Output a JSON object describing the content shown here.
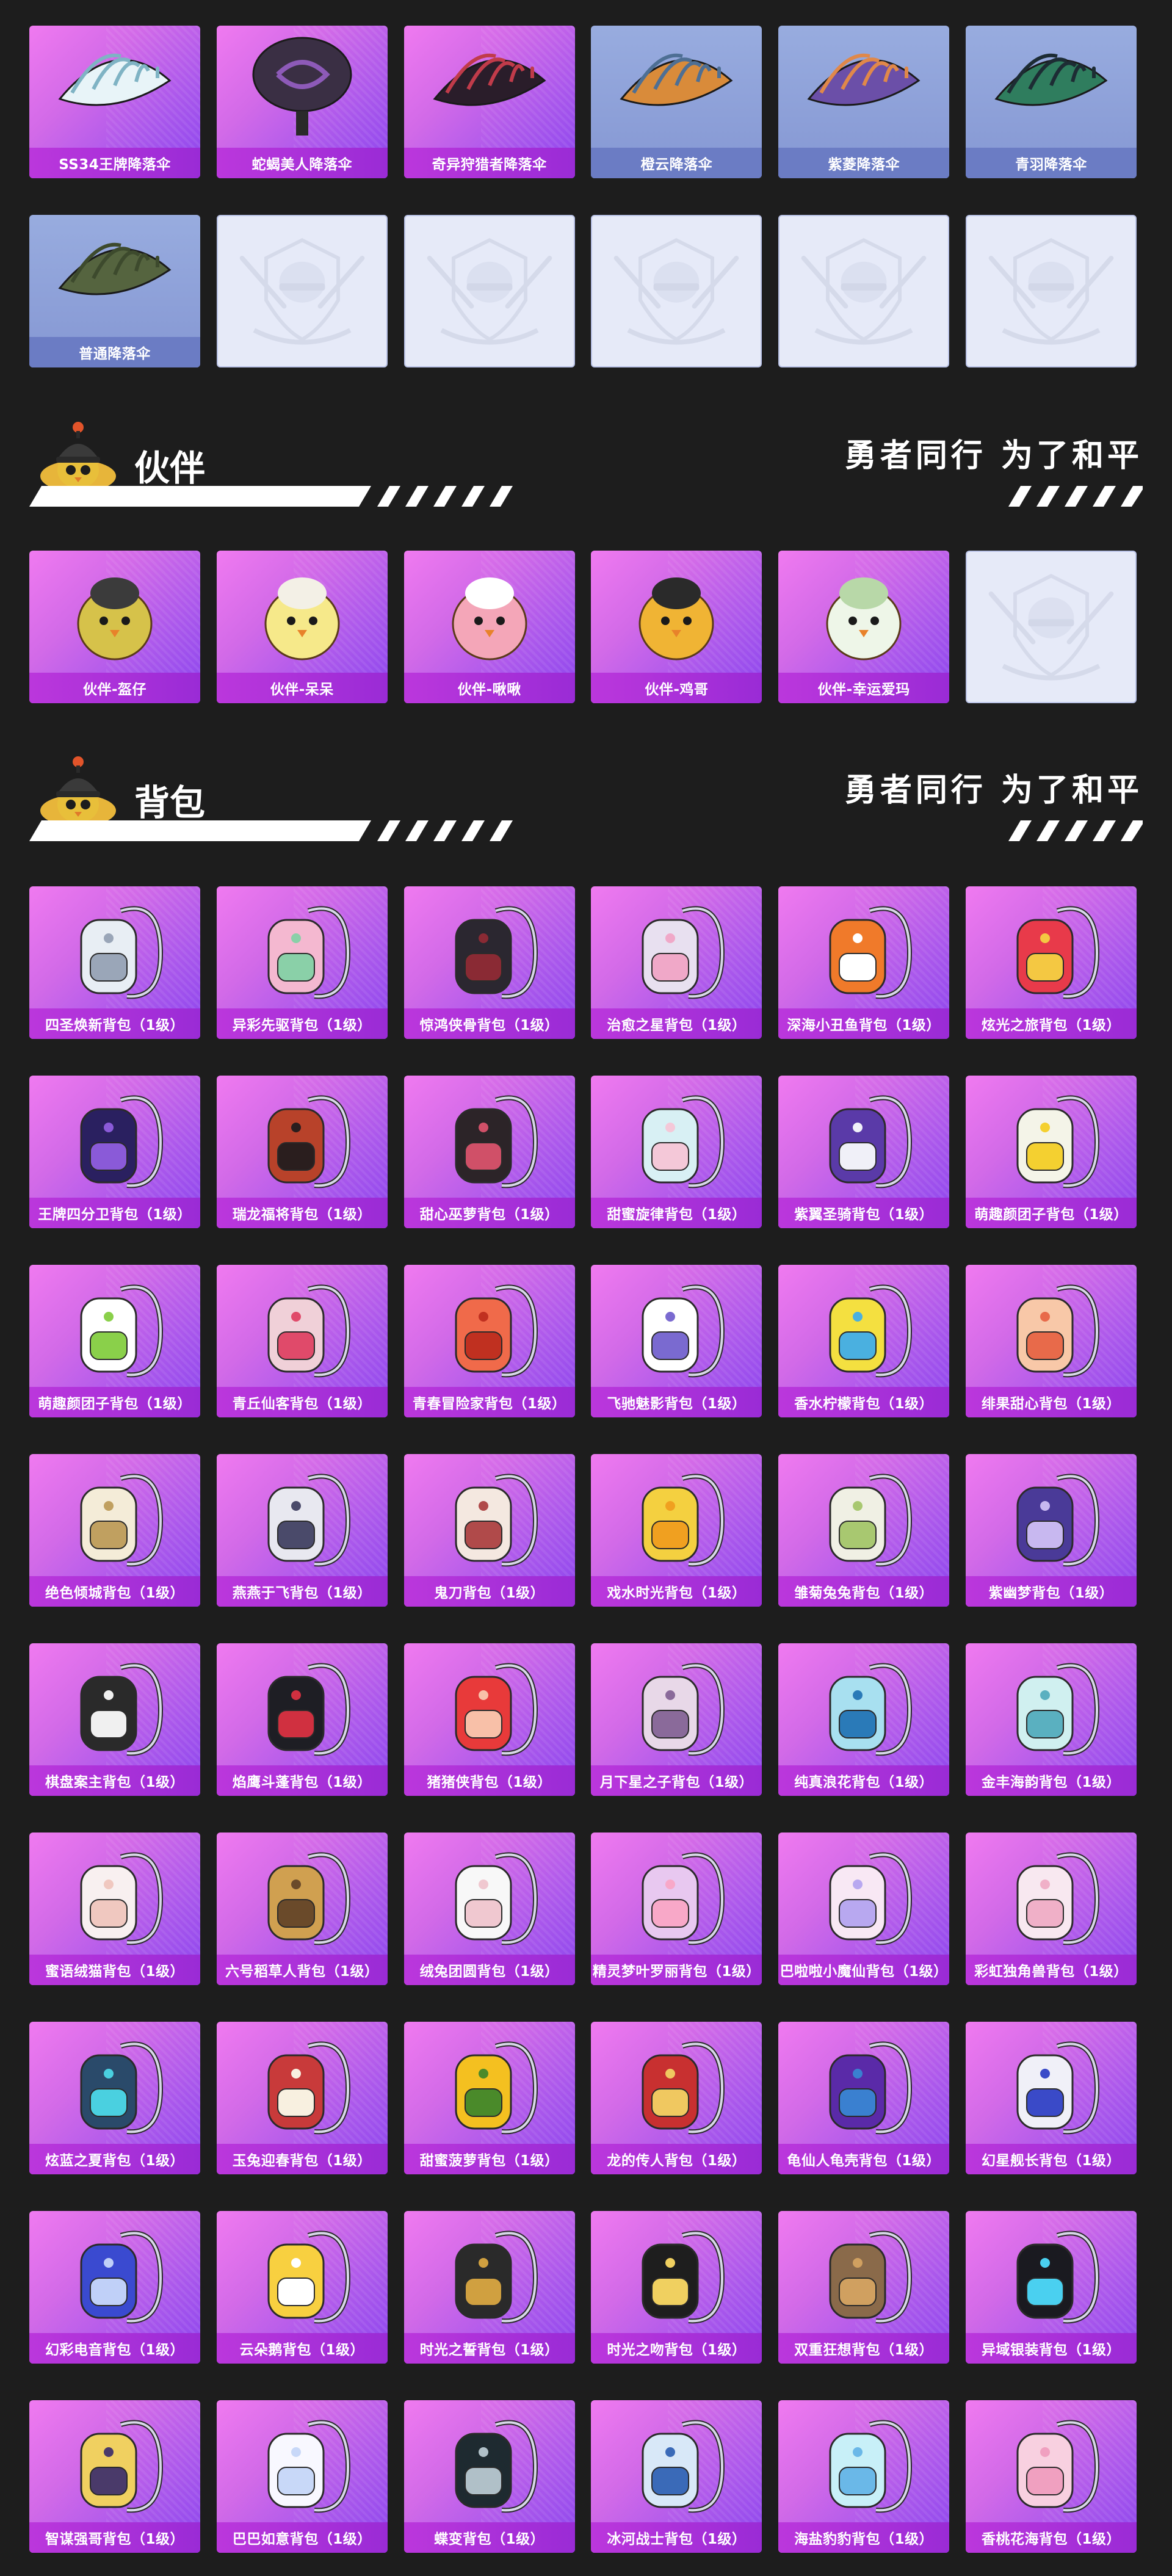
{
  "parachutes": [
    {
      "label": "SS34王牌降落伞",
      "style": "purple",
      "art": "canopy",
      "c1": "#e8f4f8",
      "c2": "#7fb3c4"
    },
    {
      "label": "蛇蝎美人降落伞",
      "style": "purple",
      "art": "round",
      "c1": "#3a2f44",
      "c2": "#8d5ab8"
    },
    {
      "label": "奇异狩猎者降落伞",
      "style": "purple",
      "art": "canopy",
      "c1": "#2a1d2a",
      "c2": "#c03b4a"
    },
    {
      "label": "橙云降落伞",
      "style": "blue",
      "art": "canopy",
      "c1": "#d98b3a",
      "c2": "#4e6f94"
    },
    {
      "label": "紫菱降落伞",
      "style": "blue",
      "art": "canopy",
      "c1": "#6b4fa8",
      "c2": "#e0884a"
    },
    {
      "label": "青羽降落伞",
      "style": "blue",
      "art": "canopy",
      "c1": "#2f7d5e",
      "c2": "#1d2c34"
    },
    {
      "label": "普通降落伞",
      "style": "blue",
      "art": "canopy",
      "c1": "#55643f",
      "c2": "#3d4a2d"
    },
    {
      "label": "",
      "style": "empty",
      "art": "emblem"
    },
    {
      "label": "",
      "style": "empty",
      "art": "emblem"
    },
    {
      "label": "",
      "style": "empty",
      "art": "emblem"
    },
    {
      "label": "",
      "style": "empty",
      "art": "emblem"
    },
    {
      "label": "",
      "style": "empty",
      "art": "emblem"
    }
  ],
  "companion_section": {
    "title": "伙伴",
    "slogan": "勇者同行 为了和平"
  },
  "companions": [
    {
      "label": "伙伴-盔仔",
      "style": "purple",
      "art": "chick",
      "c1": "#d6c24a",
      "c2": "#3b3b3b"
    },
    {
      "label": "伙伴-呆呆",
      "style": "purple",
      "art": "chick",
      "c1": "#f6e98a",
      "c2": "#f3f0e6"
    },
    {
      "label": "伙伴-啾啾",
      "style": "purple",
      "art": "chick",
      "c1": "#f4a6b8",
      "c2": "#ffffff"
    },
    {
      "label": "伙伴-鸡哥",
      "style": "purple",
      "art": "chick",
      "c1": "#f0b434",
      "c2": "#2a2a2a"
    },
    {
      "label": "伙伴-幸运爱玛",
      "style": "purple",
      "art": "chick",
      "c1": "#eef6e8",
      "c2": "#b8d8a8"
    },
    {
      "label": "",
      "style": "empty",
      "art": "emblem"
    }
  ],
  "backpack_section": {
    "title": "背包",
    "slogan": "勇者同行 为了和平"
  },
  "backpacks": [
    {
      "label": "四圣焕新背包（1级）",
      "c1": "#e8eef4",
      "c2": "#9aa6b8"
    },
    {
      "label": "异彩先驱背包（1级）",
      "c1": "#f4b8d0",
      "c2": "#8ad0a8"
    },
    {
      "label": "惊鸿侠骨背包（1级）",
      "c1": "#2b2730",
      "c2": "#8a2a34"
    },
    {
      "label": "治愈之星背包（1级）",
      "c1": "#e8e0f0",
      "c2": "#f0a8c8"
    },
    {
      "label": "深海小丑鱼背包（1级）",
      "c1": "#f07a2a",
      "c2": "#ffffff"
    },
    {
      "label": "炫光之旅背包（1级）",
      "c1": "#e83a4a",
      "c2": "#f4c842"
    },
    {
      "label": "王牌四分卫背包（1级）",
      "c1": "#2a2060",
      "c2": "#8a5ad8"
    },
    {
      "label": "瑞龙福将背包（1级）",
      "c1": "#b8422a",
      "c2": "#2a1e1e"
    },
    {
      "label": "甜心巫萝背包（1级）",
      "c1": "#2c2428",
      "c2": "#d05068"
    },
    {
      "label": "甜蜜旋律背包（1级）",
      "c1": "#d8f0f4",
      "c2": "#f4c8d8"
    },
    {
      "label": "紫翼圣骑背包（1级）",
      "c1": "#5a3aa8",
      "c2": "#f0f0f8"
    },
    {
      "label": "萌趣颜团子背包（1级）",
      "c1": "#f4f4e8",
      "c2": "#f4d030"
    },
    {
      "label": "萌趣颜团子背包（1级）",
      "c1": "#ffffff",
      "c2": "#8ad04a"
    },
    {
      "label": "青丘仙客背包（1级）",
      "c1": "#f0d0d8",
      "c2": "#e04a6a"
    },
    {
      "label": "青春冒险家背包（1级）",
      "c1": "#f06a4a",
      "c2": "#c03020"
    },
    {
      "label": "飞驰魅影背包（1级）",
      "c1": "#ffffff",
      "c2": "#7a6ad0"
    },
    {
      "label": "香水柠檬背包（1级）",
      "c1": "#f4e040",
      "c2": "#4ab0e0"
    },
    {
      "label": "绯果甜心背包（1级）",
      "c1": "#f8c8a8",
      "c2": "#e86a4a"
    },
    {
      "label": "绝色倾城背包（1级）",
      "c1": "#f4ecd8",
      "c2": "#c0a060"
    },
    {
      "label": "燕燕于飞背包（1级）",
      "c1": "#e8e8f0",
      "c2": "#4a4a6a"
    },
    {
      "label": "鬼刀背包（1级）",
      "c1": "#f4e8e0",
      "c2": "#b04a4a"
    },
    {
      "label": "戏水时光背包（1级）",
      "c1": "#f4d040",
      "c2": "#f0a020"
    },
    {
      "label": "雏菊兔兔背包（1级）",
      "c1": "#f0f0e4",
      "c2": "#a8c870"
    },
    {
      "label": "紫幽梦背包（1级）",
      "c1": "#4a3a98",
      "c2": "#c8b8f0"
    },
    {
      "label": "棋盘案主背包（1级）",
      "c1": "#2a2a2a",
      "c2": "#f0f0f0"
    },
    {
      "label": "焰鹰斗蓬背包（1级）",
      "c1": "#1e1e24",
      "c2": "#d03040"
    },
    {
      "label": "猪猪侠背包（1级）",
      "c1": "#e83a3a",
      "c2": "#f8c0a8"
    },
    {
      "label": "月下星之子背包（1级）",
      "c1": "#e8d8e8",
      "c2": "#8a6a9a"
    },
    {
      "label": "纯真浪花背包（1级）",
      "c1": "#a8e0f0",
      "c2": "#2a7ab8"
    },
    {
      "label": "金丰海韵背包（1级）",
      "c1": "#d0f0f0",
      "c2": "#5ab0c0"
    },
    {
      "label": "蜜语绒猫背包（1级）",
      "c1": "#f8f0f0",
      "c2": "#f0c8c0"
    },
    {
      "label": "六号稻草人背包（1级）",
      "c1": "#d0a050",
      "c2": "#6a4a2a"
    },
    {
      "label": "绒兔团圆背包（1级）",
      "c1": "#f8f8f8",
      "c2": "#f0c8d0"
    },
    {
      "label": "精灵梦叶罗丽背包（1级）",
      "c1": "#e8c8f0",
      "c2": "#f8a8c8"
    },
    {
      "label": "巴啦啦小魔仙背包（1级）",
      "c1": "#f8e8f4",
      "c2": "#b8a8f0"
    },
    {
      "label": "彩虹独角兽背包（1级）",
      "c1": "#f8e8f0",
      "c2": "#f0b0c8"
    },
    {
      "label": "炫蓝之夏背包（1级）",
      "c1": "#2a4a6a",
      "c2": "#4ad0e0"
    },
    {
      "label": "玉兔迎春背包（1级）",
      "c1": "#c83a3a",
      "c2": "#f8f0e0"
    },
    {
      "label": "甜蜜菠萝背包（1级）",
      "c1": "#f4c020",
      "c2": "#4a8a2a"
    },
    {
      "label": "龙的传人背包（1级）",
      "c1": "#c83030",
      "c2": "#f0c860"
    },
    {
      "label": "龟仙人龟壳背包（1级）",
      "c1": "#5a2aa8",
      "c2": "#3a80d0"
    },
    {
      "label": "幻星舰长背包（1级）",
      "c1": "#f0f0f8",
      "c2": "#3a4ac8"
    },
    {
      "label": "幻彩电音背包（1级）",
      "c1": "#3a4ad0",
      "c2": "#c0d0f8"
    },
    {
      "label": "云朵鹅背包（1级）",
      "c1": "#f8d040",
      "c2": "#ffffff"
    },
    {
      "label": "时光之誓背包（1级）",
      "c1": "#2a2a2a",
      "c2": "#d0a040"
    },
    {
      "label": "时光之吻背包（1级）",
      "c1": "#1e1e1e",
      "c2": "#f0d060"
    },
    {
      "label": "双重狂想背包（1级）",
      "c1": "#8a6a4a",
      "c2": "#d0a060"
    },
    {
      "label": "异域银装背包（1级）",
      "c1": "#1a1a20",
      "c2": "#4ad0f0"
    },
    {
      "label": "智谋强哥背包（1级）",
      "c1": "#f0d060",
      "c2": "#4a3a6a"
    },
    {
      "label": "巴巴如意背包（1级）",
      "c1": "#f8f8ff",
      "c2": "#c8d8f8"
    },
    {
      "label": "蝶变背包（1级）",
      "c1": "#1e2a30",
      "c2": "#b0c0c8"
    },
    {
      "label": "冰河战士背包（1级）",
      "c1": "#d8e8f8",
      "c2": "#3a6ab8"
    },
    {
      "label": "海盐豹豹背包（1级）",
      "c1": "#c8f0f8",
      "c2": "#6ab8e8"
    },
    {
      "label": "香桃花海背包（1级）",
      "c1": "#f8d0e0",
      "c2": "#f0a0c0"
    }
  ]
}
